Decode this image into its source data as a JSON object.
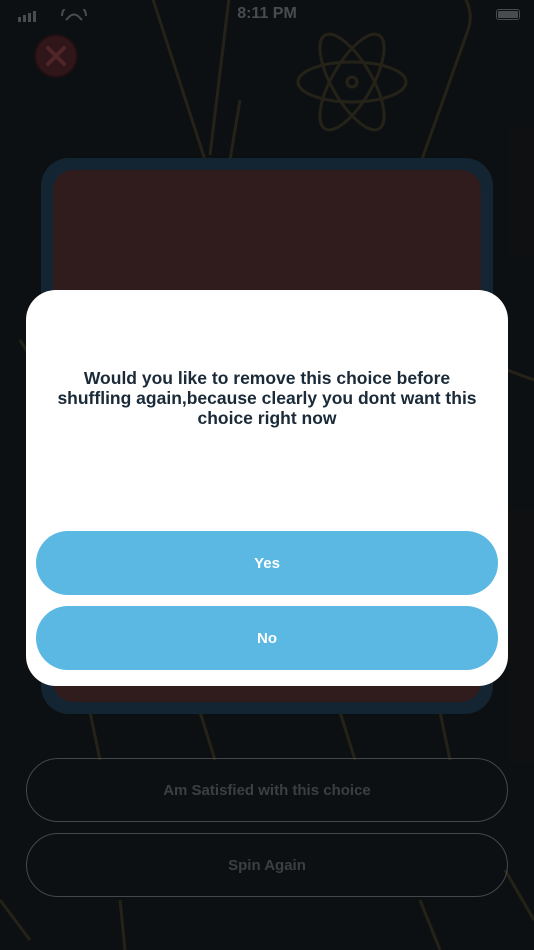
{
  "status_bar": {
    "time": "8:11 PM"
  },
  "close_button": {
    "icon": "close-icon"
  },
  "actions": {
    "satisfied_label": "Am Satisfied with this choice",
    "spin_again_label": "Spin Again"
  },
  "dialog": {
    "message": "Would you like to remove this choice before shuffling again,because clearly you dont want this choice right now",
    "yes_label": "Yes",
    "no_label": "No"
  },
  "colors": {
    "background": "#15191c",
    "card_border": "#1e3a4d",
    "card_fill": "#4a2a2d",
    "dialog_button": "#5bb8e2",
    "dialog_text": "#1a2a38",
    "art_stroke": "#3a3526"
  }
}
